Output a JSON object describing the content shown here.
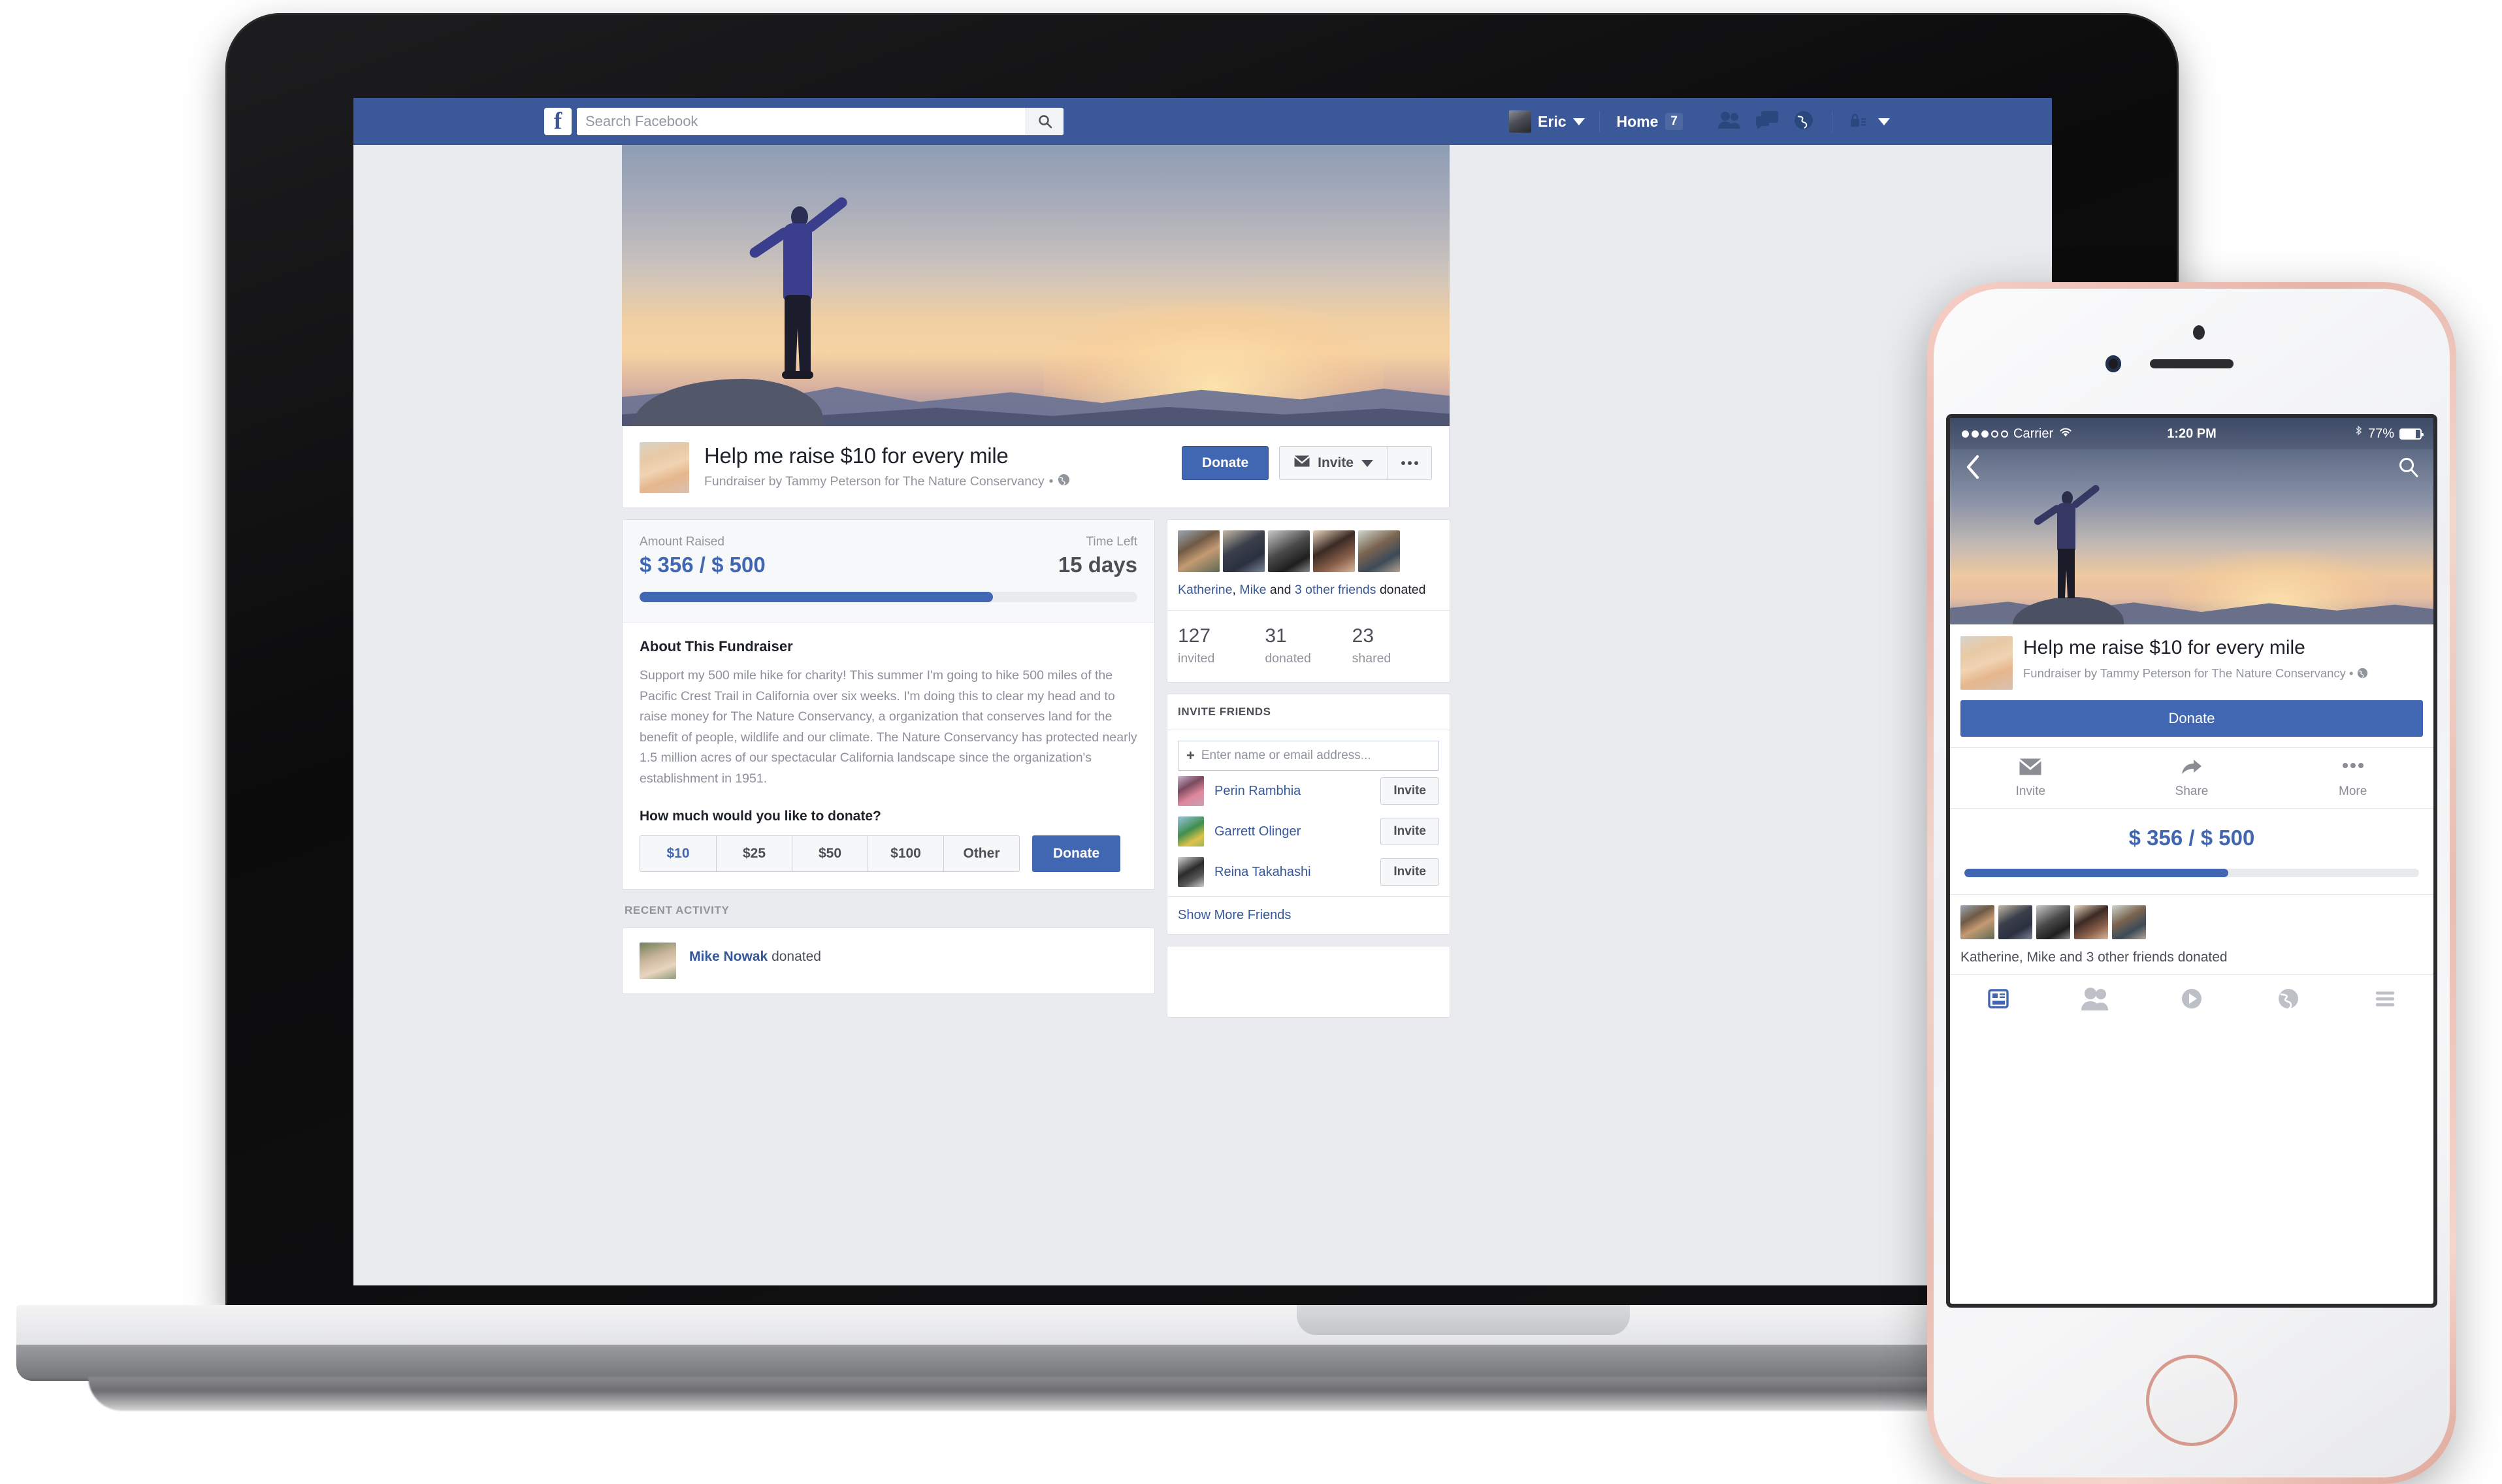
{
  "desktop": {
    "nav": {
      "logo": "f",
      "search_placeholder": "Search Facebook",
      "search_icon": "search-icon",
      "user_name": "Eric",
      "home_label": "Home",
      "home_badge": "7",
      "icons": [
        "friend-requests-icon",
        "messages-icon",
        "notifications-globe-icon",
        "privacy-lock-icon",
        "account-caret-icon"
      ]
    },
    "fundraiser": {
      "title": "Help me raise $10 for every mile",
      "subtitle": "Fundraiser by Tammy Peterson for The Nature Conservancy",
      "privacy_icon": "globe-public-icon",
      "donate_label": "Donate",
      "invite_label": "Invite",
      "more_label": "•••"
    },
    "progress": {
      "raised_label": "Amount Raised",
      "raised_value": "$ 356 / $ 500",
      "time_label": "Time Left",
      "time_value": "15 days",
      "percent": 71,
      "bar_color": "#4267b2"
    },
    "about": {
      "heading": "About This Fundraiser",
      "body": "Support my 500 mile hike for charity! This summer I'm going to hike 500 miles of the Pacific Crest Trail in California over six weeks. I'm doing this to clear my head and to raise money for The Nature Conservancy, a organization that conserves land for the benefit of people, wildlife and our climate. The Nature Conservancy has protected nearly 1.5 million acres of our spectacular California landscape since the organization's establishment in 1951.",
      "ask_heading": "How much would you like to donate?",
      "amounts": [
        "$10",
        "$25",
        "$50",
        "$100",
        "Other"
      ],
      "selected_amount": "$10",
      "donate_label": "Donate"
    },
    "recent_activity": {
      "section_label": "RECENT ACTIVITY",
      "items": [
        {
          "name": "Mike Nowak",
          "action": "donated"
        }
      ]
    },
    "donors": {
      "line_parts": [
        "Katherine",
        ", ",
        "Mike",
        " and ",
        "3 other friends",
        " donated"
      ],
      "stats": [
        {
          "number": "127",
          "label": "invited"
        },
        {
          "number": "31",
          "label": "donated"
        },
        {
          "number": "23",
          "label": "shared"
        }
      ]
    },
    "invite_friends": {
      "heading": "INVITE FRIENDS",
      "input_placeholder": "Enter name or email address...",
      "add_icon": "plus-icon",
      "friends": [
        {
          "name": "Perin Rambhia",
          "button": "Invite"
        },
        {
          "name": "Garrett Olinger",
          "button": "Invite"
        },
        {
          "name": "Reina Takahashi",
          "button": "Invite"
        }
      ],
      "show_more": "Show More Friends"
    }
  },
  "mobile": {
    "status_bar": {
      "carrier": "Carrier",
      "time": "1:20 PM",
      "battery": "77%",
      "bluetooth_icon": "bluetooth-icon",
      "wifi_icon": "wifi-icon"
    },
    "nav": {
      "back_icon": "chevron-left-icon",
      "search_icon": "search-icon"
    },
    "fundraiser": {
      "title": "Help me raise $10 for every mile",
      "subtitle": "Fundraiser by Tammy Peterson for The Nature Conservancy • ",
      "privacy_icon": "globe-public-icon",
      "donate_label": "Donate"
    },
    "actions": [
      {
        "label": "Invite",
        "icon": "envelope-icon"
      },
      {
        "label": "Share",
        "icon": "share-arrow-icon"
      },
      {
        "label": "More",
        "icon": "ellipsis-icon"
      }
    ],
    "progress": {
      "raised_value": "$ 356 / $ 500",
      "percent": 58,
      "bar_color": "#4267b2"
    },
    "donors": {
      "line": "Katherine, Mike and 3 other friends donated"
    },
    "tabs": [
      {
        "icon": "news-feed-icon",
        "active": true
      },
      {
        "icon": "friends-icon",
        "active": false
      },
      {
        "icon": "video-play-icon",
        "active": false
      },
      {
        "icon": "notifications-globe-icon",
        "active": false
      },
      {
        "icon": "hamburger-menu-icon",
        "active": false
      }
    ]
  },
  "colors": {
    "fb_blue": "#3b5998",
    "fb_button_blue": "#4267b2",
    "link_blue": "#365899",
    "page_bg": "#e9ebee",
    "text_dark": "#1d2129",
    "text_muted": "#90949c"
  }
}
